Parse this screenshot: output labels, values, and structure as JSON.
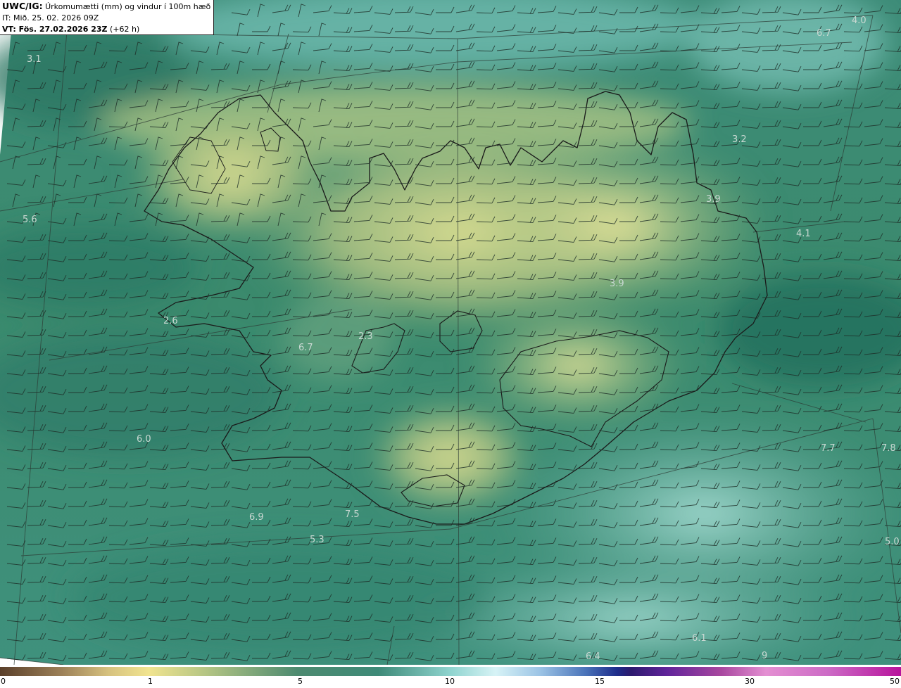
{
  "header": {
    "title_bold": "UWC/IG:",
    "title_rest": " Úrkomumætti (mm) og vindur í 100m hæð",
    "init_line": "IT: Mið. 25. 02. 2026 09Z",
    "valid_bold": "VT: Fös. 27.02.2026 23Z",
    "valid_rest": " (+62 h)"
  },
  "colorbar": {
    "ticks": [
      "0",
      "1",
      "5",
      "10",
      "15",
      "30",
      "50"
    ]
  },
  "map_labels": [
    "3.1",
    "6.7",
    "4.0",
    "3.2",
    "5.6",
    "3.9",
    "4.1",
    "3.9",
    "2.6",
    "6.7",
    "2.3",
    "6.0",
    "7.7",
    "7.8",
    "6.9",
    "7.5",
    "5.3",
    "5.0",
    "6.1",
    "6.4",
    "9"
  ],
  "colors": {
    "sea_dark": "#236e5c",
    "sea_mid": "#3a8a72",
    "land_light": "#d4d98f",
    "sea_light": "#8fcfc6",
    "coast": "#1a1a1a",
    "barb": "#1f2f29"
  }
}
